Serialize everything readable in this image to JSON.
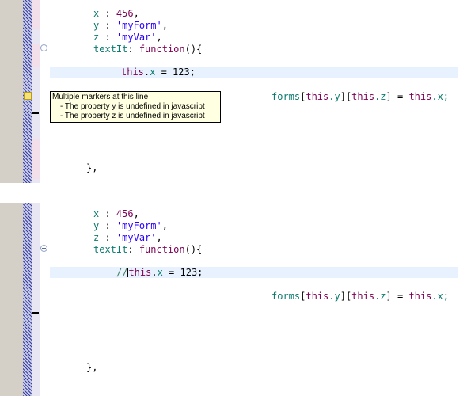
{
  "pane_top": {
    "lines": {
      "x": {
        "key": "x",
        "sep": " : ",
        "val": "456",
        "end": ","
      },
      "y": {
        "key": "y",
        "sep": " : ",
        "val": "'myForm'",
        "end": ","
      },
      "z": {
        "key": "z",
        "sep": " : ",
        "val": "'myVar'",
        "end": ","
      },
      "fn": {
        "key": "textIt",
        "sep": ": ",
        "kw": "function",
        "end": "(){"
      },
      "assign": {
        "obj": "this",
        "dot": ".",
        "prop": "x",
        "rest": " = 123;"
      },
      "forms": {
        "a": "forms",
        "b": "[",
        "c": "this",
        "d": ".y",
        "e": "][",
        "f": "this",
        "g": ".z",
        "h": "] = ",
        "i": "this",
        "j": ".x;"
      },
      "close": "},"
    },
    "tooltip": {
      "title": "Multiple markers at this line",
      "items": [
        "- The property y is undefined in javascript",
        "- The property z is undefined in javascript"
      ]
    }
  },
  "pane_bottom": {
    "lines": {
      "x": {
        "key": "x",
        "sep": " : ",
        "val": "456",
        "end": ","
      },
      "y": {
        "key": "y",
        "sep": " : ",
        "val": "'myForm'",
        "end": ","
      },
      "z": {
        "key": "z",
        "sep": " : ",
        "val": "'myVar'",
        "end": ","
      },
      "fn": {
        "key": "textIt",
        "sep": ": ",
        "kw": "function",
        "end": "(){"
      },
      "assign": {
        "comment": "//",
        "obj": "this",
        "dot": ".",
        "prop": "x",
        "rest": " = 123;"
      },
      "forms": {
        "a": "forms",
        "b": "[",
        "c": "this",
        "d": ".y",
        "e": "][",
        "f": "this",
        "g": ".z",
        "h": "] = ",
        "i": "this",
        "j": ".x;"
      },
      "close": "},"
    }
  }
}
